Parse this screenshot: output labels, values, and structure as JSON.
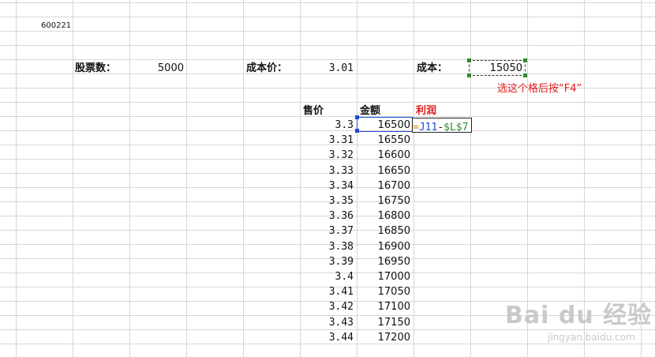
{
  "sheet": {
    "code_cell": "600221",
    "shares_label": "股票数：",
    "shares_value": "5000",
    "cost_price_label": "成本价：",
    "cost_price_value": "3.01",
    "cost_label": "成本：",
    "cost_value": "15050",
    "headers": {
      "price": "售价",
      "amount": "金额",
      "profit": "利润"
    },
    "rows": [
      {
        "price": "3.3",
        "amount": "16500"
      },
      {
        "price": "3.31",
        "amount": "16550"
      },
      {
        "price": "3.32",
        "amount": "16600"
      },
      {
        "price": "3.33",
        "amount": "16650"
      },
      {
        "price": "3.34",
        "amount": "16700"
      },
      {
        "price": "3.35",
        "amount": "16750"
      },
      {
        "price": "3.36",
        "amount": "16800"
      },
      {
        "price": "3.37",
        "amount": "16850"
      },
      {
        "price": "3.38",
        "amount": "16900"
      },
      {
        "price": "3.39",
        "amount": "16950"
      },
      {
        "price": "3.4",
        "amount": "17000"
      },
      {
        "price": "3.41",
        "amount": "17050"
      },
      {
        "price": "3.42",
        "amount": "17100"
      },
      {
        "price": "3.43",
        "amount": "17150"
      },
      {
        "price": "3.44",
        "amount": "17200"
      }
    ],
    "formula": {
      "eq": "=",
      "ref_amount": "J11",
      "op": "-",
      "ref_cost": "$L$7"
    }
  },
  "annotation": "选这个格后按“F4”",
  "watermark": {
    "brand": "Bai du 经验",
    "url": "jingyan.baidu.com"
  },
  "colors": {
    "grid": "#d6d6d6",
    "selection": "#1f4bd6",
    "annotation": "#e21a1a",
    "profit_header": "#e21a1a",
    "formula_ref_absolute": "#2e8b2e"
  }
}
